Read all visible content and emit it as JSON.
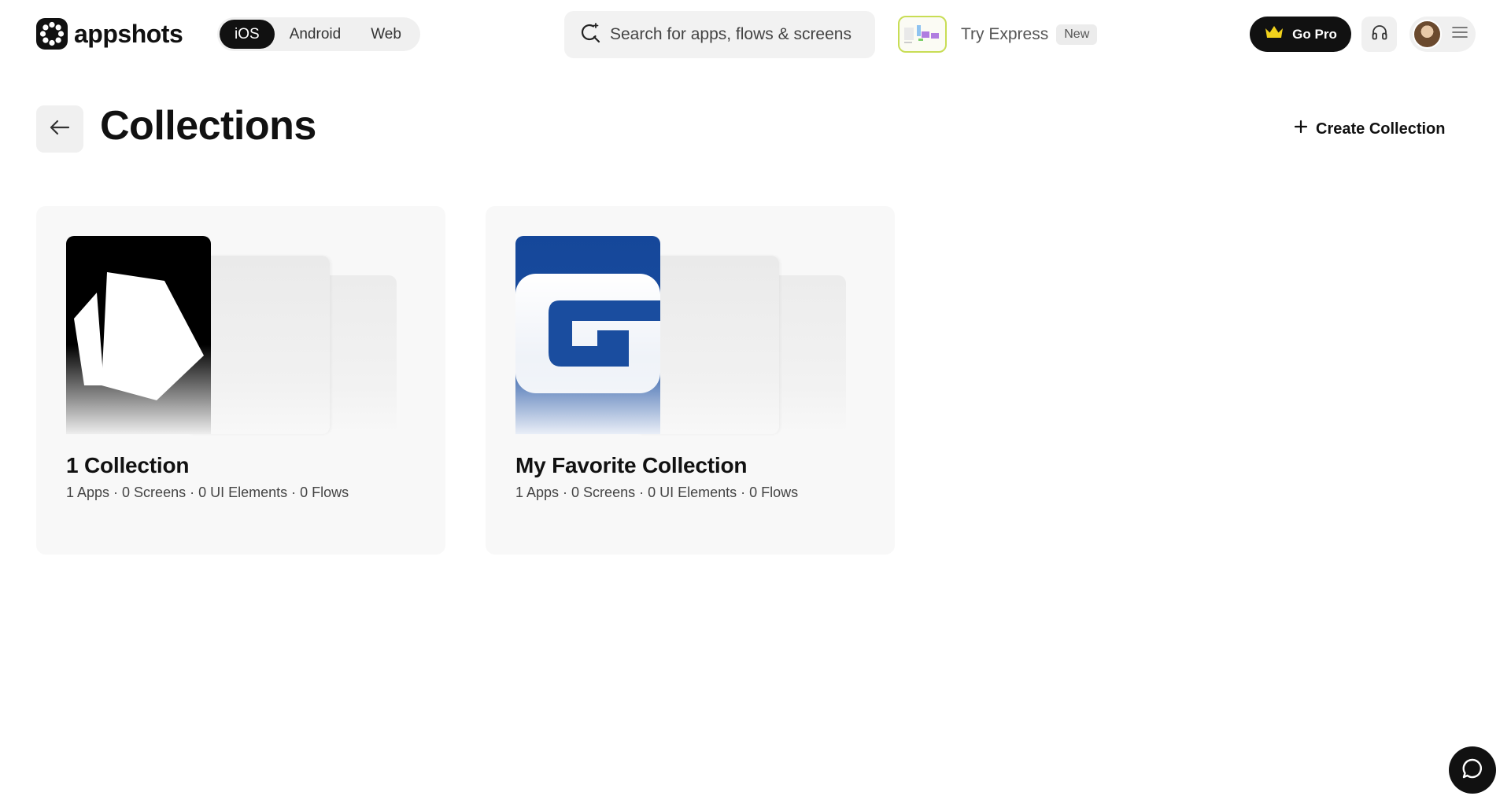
{
  "brand": {
    "name": "appshots"
  },
  "platforms": [
    {
      "label": "iOS",
      "active": true
    },
    {
      "label": "Android",
      "active": false
    },
    {
      "label": "Web",
      "active": false
    }
  ],
  "search": {
    "placeholder": "Search for apps, flows & screens"
  },
  "express": {
    "label": "Try Express",
    "badge": "New"
  },
  "header_actions": {
    "gopro_label": "Go Pro"
  },
  "page": {
    "title": "Collections",
    "create_label": "Create Collection"
  },
  "collections": [
    {
      "title": "1 Collection",
      "meta": "1 Apps · 0 Screens · 0 UI Elements · 0 Flows",
      "cover_icon": "hexagon-app-icon"
    },
    {
      "title": "My Favorite Collection",
      "meta": "1 Apps · 0 Screens · 0 UI Elements · 0 Flows",
      "cover_icon": "g-letter-app-icon"
    }
  ],
  "colors": {
    "primary": "#111111",
    "surface": "#f0f0f0",
    "card": "#f8f8f8",
    "brand_blue": "#1a4a9a",
    "express_border": "#c8dd55"
  },
  "icons": {
    "search": "sparkle-search-icon",
    "back": "arrow-left-icon",
    "create": "plus-icon",
    "gopro": "crown-icon",
    "support": "headphones-icon",
    "menu": "hamburger-icon",
    "chat": "chat-bubble-icon"
  }
}
